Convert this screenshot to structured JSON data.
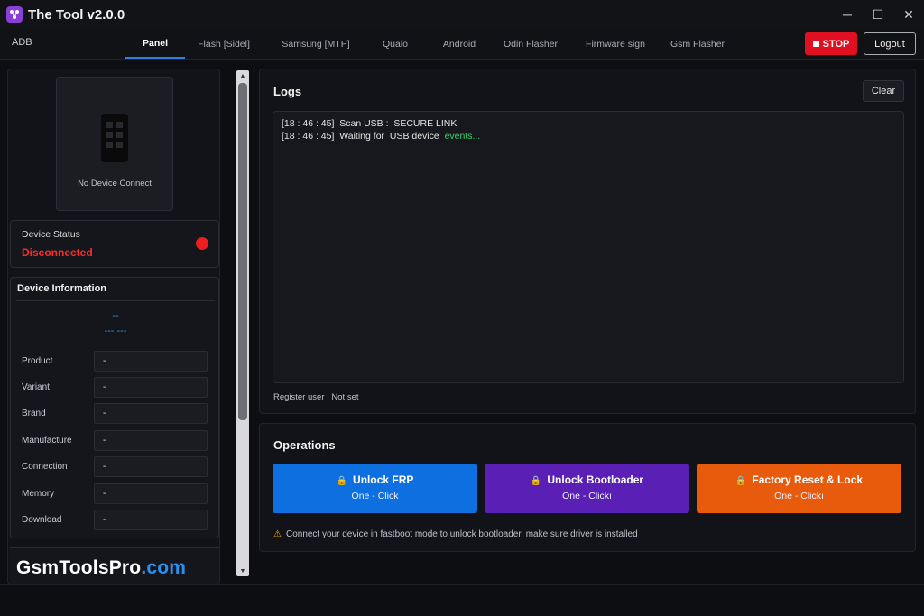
{
  "window": {
    "title": "The Tool v2.0.0",
    "icon": "app-logo-icon",
    "controls": {
      "minimize": "─",
      "maximize": "☐",
      "close": "✕"
    }
  },
  "nav": {
    "left_label": "ADB",
    "tabs": [
      "Panel",
      "Flash [Sidel]",
      "Samsung [MTP]",
      "Qualo",
      "Android",
      "Odin Flasher",
      "Firmware sign",
      "Gsm Flasher"
    ],
    "active_tab": "Panel",
    "stop_label": "STOP",
    "logout_label": "Logout",
    "stop_color": "#e01022"
  },
  "device": {
    "no_device_text": "No Device Connect",
    "status_label": "Device Status",
    "status_value": "Disconnected",
    "status_color": "#ff2a2a"
  },
  "device_info": {
    "title": "Device Information",
    "header_line1": "--",
    "header_line2": "--- ---",
    "rows": [
      {
        "key": "Product",
        "value": "-"
      },
      {
        "key": "Variant",
        "value": "-"
      },
      {
        "key": "Brand",
        "value": "-"
      },
      {
        "key": "Manufacture",
        "value": "-"
      },
      {
        "key": "Connection",
        "value": "-"
      },
      {
        "key": "Memory",
        "value": "-"
      },
      {
        "key": "Download",
        "value": "-"
      }
    ]
  },
  "brand": {
    "part1": "GsmToolsPro",
    "part2": ".com"
  },
  "logs": {
    "title": "Logs",
    "clear_label": "Clear",
    "lines": [
      {
        "time": "[18 : 46 : 45]",
        "text": "Scan USB :  SECURE LINK",
        "highlight": ""
      },
      {
        "time": "[18 : 46 : 45]",
        "text": "Waiting for  USB device",
        "highlight": "events..."
      }
    ],
    "register_user": "Register user : Not set"
  },
  "operations": {
    "title": "Operations",
    "buttons": [
      {
        "label": "Unlock FRP",
        "sub": "One - Click",
        "color": "#0e6fe0"
      },
      {
        "label": "Unlock Bootloader",
        "sub": "One - Clickı",
        "color": "#5a1fb4"
      },
      {
        "label": "Factory Reset & Lock",
        "sub": "One - Clickı",
        "color": "#e85b0c"
      }
    ],
    "note": "Connect your device in fastboot mode to unlock bootloader, make sure driver is installed"
  }
}
